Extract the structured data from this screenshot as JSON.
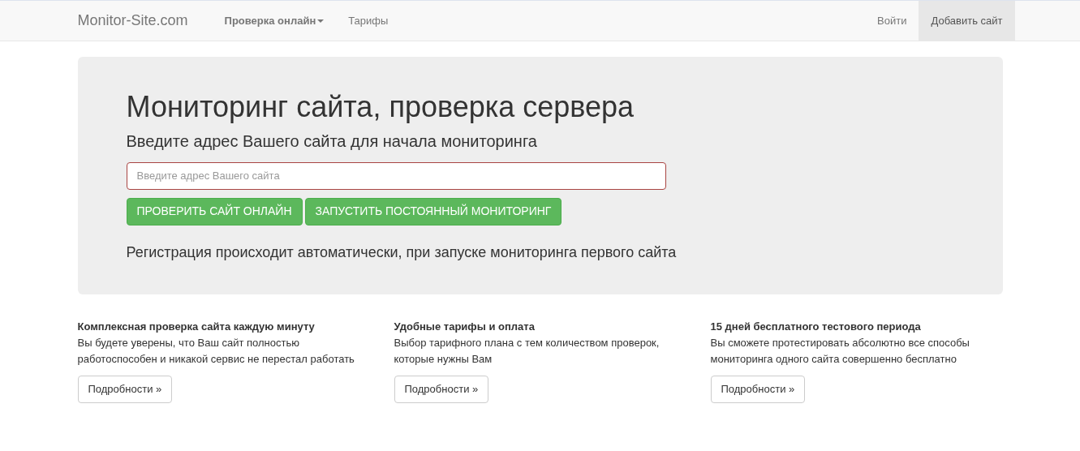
{
  "navbar": {
    "brand": "Monitor-Site.com",
    "left_items": [
      {
        "label": "Проверка онлайн",
        "dropdown": true,
        "selected": false
      },
      {
        "label": "Тарифы",
        "dropdown": false,
        "selected": false
      }
    ],
    "right_items": [
      {
        "label": "Войти",
        "dropdown": false,
        "selected": false
      },
      {
        "label": "Добавить сайт",
        "dropdown": false,
        "selected": true
      }
    ]
  },
  "hero": {
    "title": "Мониторинг сайта, проверка сервера",
    "subtitle": "Введите адрес Вашего сайта для начала мониторинга",
    "input": {
      "placeholder": "Введите адрес Вашего сайта",
      "invalid": true
    },
    "buttons": [
      "ПРОВЕРИТЬ САЙТ ОНЛАЙН",
      "ЗАПУСТИТЬ ПОСТОЯННЫЙ МОНИТОРИНГ"
    ],
    "note": "Регистрация происходит автоматически, при запуске мониторинга первого сайта"
  },
  "features": [
    {
      "title": "Комплексная проверка сайта каждую минуту",
      "text": "Вы будете уверены, что Ваш сайт полностью работоспособен и никакой сервис не перестал работать",
      "button": "Подробности »"
    },
    {
      "title": "Удобные тарифы и оплата",
      "text": "Выбор тарифного плана с тем количеством проверок, которые нужны Вам",
      "button": "Подробности »"
    },
    {
      "title": "15 дней бесплатного тестового периода",
      "text": "Вы сможете протестировать абсолютно все способы мониторинга одного сайта совершенно бесплатно",
      "button": "Подробности »"
    }
  ]
}
